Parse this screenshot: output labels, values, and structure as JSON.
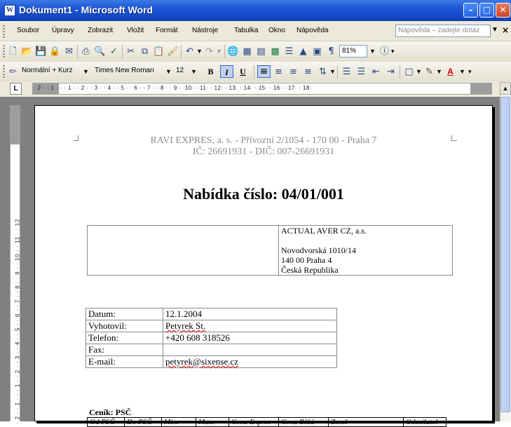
{
  "window": {
    "title": "Dokument1 - Microsoft Word",
    "app_icon_glyph": "W"
  },
  "menu": {
    "items": [
      "Soubor",
      "Úpravy",
      "Zobrazit",
      "Vložit",
      "Formát",
      "Nástroje",
      "Tabulka",
      "Okno",
      "Nápověda"
    ],
    "help_placeholder": "Nápověda – zadejte dotaz"
  },
  "standard_toolbar": {
    "zoom": "81%"
  },
  "formatting_toolbar": {
    "style": "Normální + Kurz",
    "font": "Times New Roman",
    "size": "12",
    "bold_label": "B",
    "italic_label": "I",
    "underline_label": "U",
    "font_color_label": "A"
  },
  "rulers": {
    "horizontal": "· 2 · · 1 · · · 1 · · 2 · · 3 · · 4 · · 5 · · 6 · · 7 · · 8 · · 9 · ·10· · 11· · 12· · 13· · 14· · 15· · 16· · 17· · 18·",
    "vertical": "· 2 · · 1 · · · 1 · · 2 · · 3 · · 4 · · 5 · · 6 · · 7 · · 8 · · 9 · · 10 · · 11 · · 12"
  },
  "document": {
    "header_line1": "RAVI EXPRES, a. s. - Přívozní 2/1054 - 170 00 - Praha 7",
    "header_line2": "IČ: 26691931 - DIČ: 007-26691931",
    "title": "Nabídka číslo: 04/01/001",
    "recipient": {
      "company": "ACTUAL AVER CZ, a.s.",
      "street": "Novodvorská 1010/14",
      "city": "140 00   Praha 4",
      "country": "Česká Republika"
    },
    "info_rows": [
      {
        "label": "Datum:",
        "value": "12.1.2004"
      },
      {
        "label": "Vyhotovil:",
        "value": "Petyrek St."
      },
      {
        "label": "Telefon:",
        "value": "+420 608 318526"
      },
      {
        "label": "Fax:",
        "value": ""
      },
      {
        "label": "E-mail:",
        "value": "petyrek@sixense.cz"
      }
    ],
    "pricelist_title": "Ceník: PSČ",
    "pricelist_headers": [
      "Od PSČ",
      "Do PSČ",
      "Min.",
      "Max.",
      "Cena Expres",
      "Cena Běžá",
      "Země",
      "Odesílatel"
    ]
  }
}
